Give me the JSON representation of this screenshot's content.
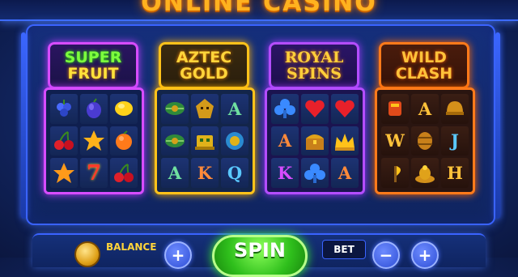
{
  "header": {
    "title": "ONLINE CASINO"
  },
  "machines": [
    {
      "name_lines": [
        "SUPER",
        "FRUIT"
      ],
      "symbols": [
        "grapes-icon",
        "plum-icon",
        "lemon-icon",
        "cherries-icon",
        "star-icon",
        "orange-icon",
        "star-icon",
        "seven-icon",
        "cherries-icon"
      ],
      "seven_label": "7"
    },
    {
      "name_lines": [
        "AZTEC",
        "GOLD"
      ],
      "symbols": [
        "jungle-leaf-icon",
        "aztec-mask-icon",
        "letter-a",
        "jungle-leaf-icon",
        "golden-idol-icon",
        "blue-mask-icon",
        "letter-a",
        "letter-k",
        "letter-q"
      ],
      "letters": {
        "a1": "A",
        "a2": "A",
        "k": "K",
        "q": "Q"
      }
    },
    {
      "name_lines": [
        "ROYAL",
        "SPINS"
      ],
      "symbols": [
        "club-icon",
        "heart-icon",
        "heart-icon",
        "letter-a",
        "treasure-chest-icon",
        "crown-icon",
        "letter-k",
        "club-icon",
        "letter-a"
      ],
      "letters": {
        "a1": "A",
        "k": "K",
        "a2": "A"
      }
    },
    {
      "name_lines": [
        "WILD",
        "CLASH"
      ],
      "symbols": [
        "armor-icon",
        "letter-a",
        "war-helmet-icon",
        "letter-w",
        "barrel-icon",
        "letter-j",
        "axe-icon",
        "gold-pile-icon",
        "letter-h"
      ],
      "letters": {
        "a": "A",
        "w": "W",
        "j": "J",
        "h": "H"
      }
    }
  ],
  "controls": {
    "balance_label": "BALANCE",
    "spin_label": "SPIN",
    "bet_label": "BET",
    "plus_symbol": "+",
    "minus_symbol": "−"
  },
  "colors": {
    "background": "#142a6b",
    "frame_neon": "#3a63ff",
    "title_gold": "#ffb21f",
    "spin_green": "#2fbf1c",
    "super_fruit_neon": "#d74cff",
    "aztec_gold_neon": "#ffc21a",
    "royal_spins_neon": "#b44dff",
    "wild_clash_neon": "#ff7a1a"
  }
}
